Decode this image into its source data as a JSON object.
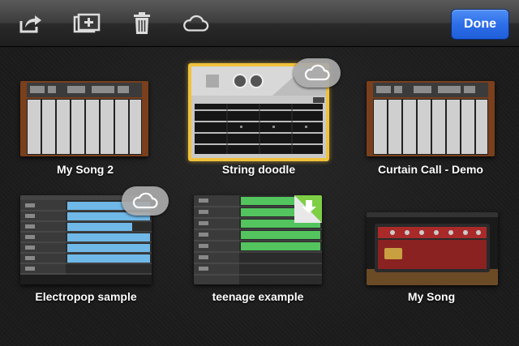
{
  "toolbar": {
    "icons": [
      "share-icon",
      "add-song-icon",
      "trash-icon",
      "cloud-icon"
    ],
    "done_label": "Done",
    "done_color": "#2d6ee8"
  },
  "songs": [
    {
      "title": "My Song 2",
      "instrument": "keyboard"
    },
    {
      "title": "String doodle",
      "instrument": "strings",
      "selected": true,
      "icloud": true
    },
    {
      "title": "Curtain Call - Demo",
      "instrument": "keyboard"
    },
    {
      "title": "Electropop sample",
      "instrument": "tracks",
      "icloud": true
    },
    {
      "title": "teenage example",
      "instrument": "tracks",
      "download": true
    },
    {
      "title": "My Song",
      "instrument": "guitar-amp"
    }
  ],
  "colors": {
    "selection": "#f0c23c",
    "track_blue": "#6fb8e8",
    "track_green": "#53c45e",
    "wood": "#8a4a23"
  }
}
